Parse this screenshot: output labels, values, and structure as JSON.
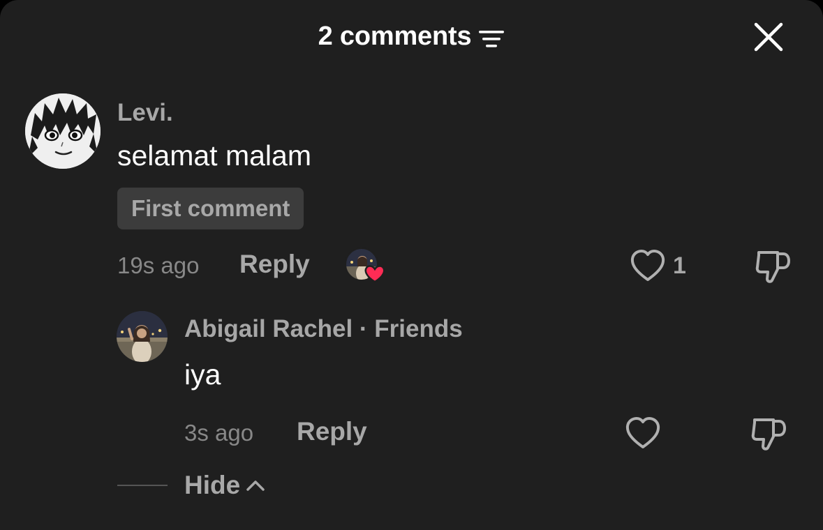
{
  "header": {
    "title": "2 comments",
    "sort_icon": "sort-filter-icon",
    "close_icon": "close-icon"
  },
  "comments": [
    {
      "username": "Levi.",
      "text": "selamat malam",
      "badge": "First comment",
      "time": "19s ago",
      "reply_label": "Reply",
      "like_count": "1",
      "liked_by_icon": "creator-liked-avatar-heart-icon"
    }
  ],
  "replies": [
    {
      "username": "Abigail Rachel",
      "separator": " · ",
      "relation": "Friends",
      "text": "iya",
      "time": "3s ago",
      "reply_label": "Reply"
    }
  ],
  "hide_label": "Hide",
  "colors": {
    "background": "#1f1f1f",
    "heart_accent": "#fe2c55",
    "text_primary": "#ffffff",
    "text_secondary": "#a8a8a8"
  }
}
